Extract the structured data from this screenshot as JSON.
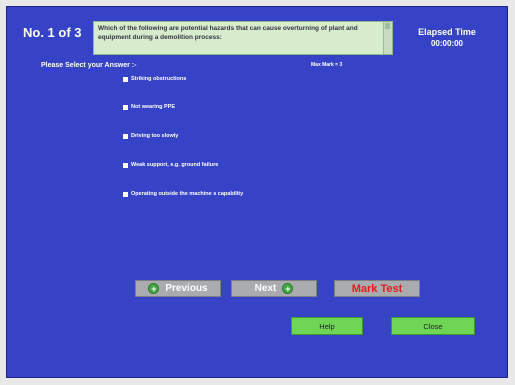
{
  "header": {
    "question_counter": "No. 1 of 3",
    "question_text": "Which of the following are potential hazards that can cause overturning of plant and equipment during a demolition process:",
    "elapsed_label": "Elapsed Time",
    "elapsed_value": "00:00:00"
  },
  "prompt": "Please Select your Answer :-",
  "max_mark": "Max Mark = 3",
  "options": [
    {
      "label": "Striking obstructions",
      "checked": false
    },
    {
      "label": "Not wearing PPE",
      "checked": false
    },
    {
      "label": "Driving too slowly",
      "checked": false
    },
    {
      "label": "Weak support, e.g. ground failure",
      "checked": false
    },
    {
      "label": "Operating outside the machine s capability",
      "checked": false
    }
  ],
  "nav": {
    "previous_label": "Previous",
    "next_label": "Next",
    "mark_label": "Mark Test"
  },
  "footer": {
    "help_label": "Help",
    "close_label": "Close"
  },
  "colors": {
    "panel": "#3643c6",
    "question_box": "#d6eccc",
    "green_button": "#6fd655",
    "mark_text": "#e51a1a"
  },
  "icons": {
    "previous": "plus-circle-icon",
    "next": "plus-circle-icon"
  }
}
